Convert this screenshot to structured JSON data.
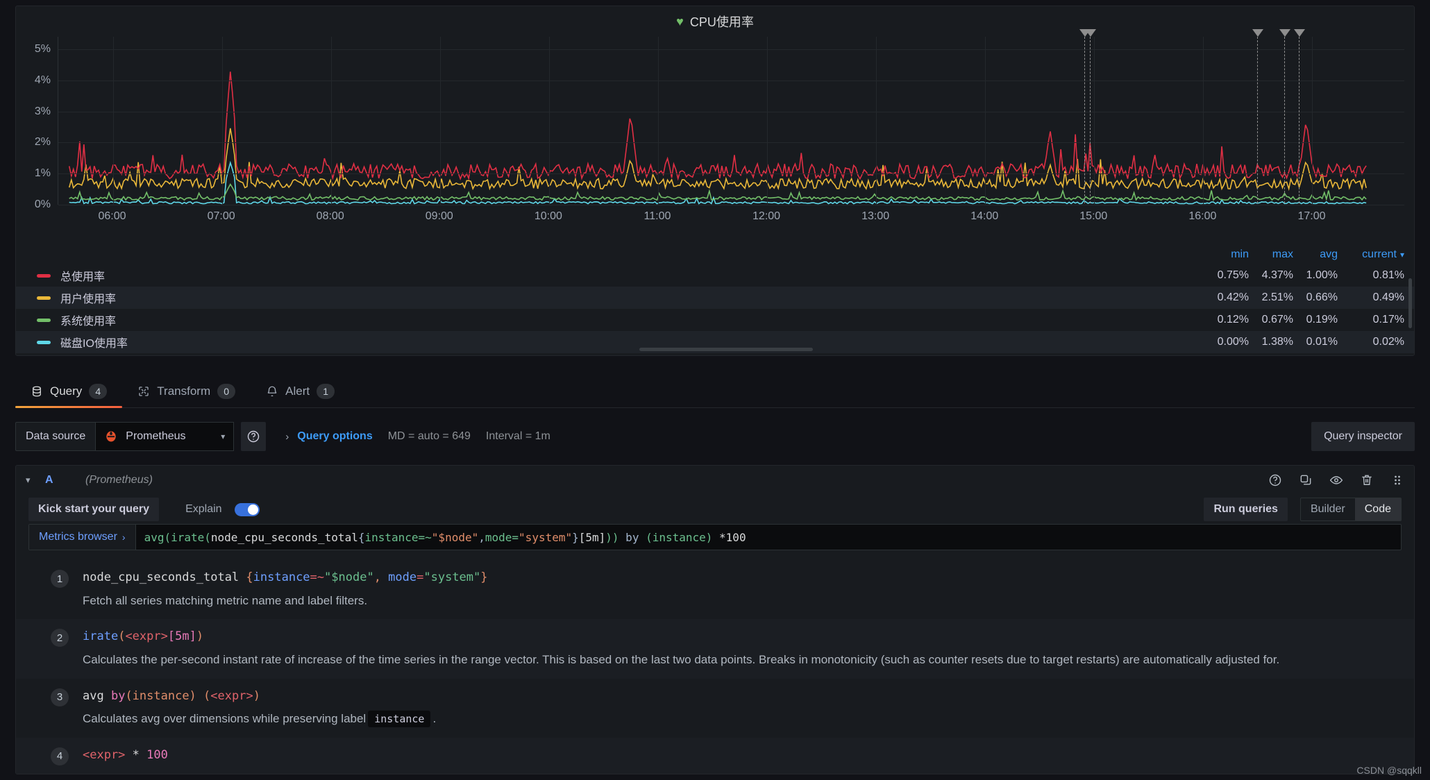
{
  "panel": {
    "title": "CPU使用率",
    "status_icon": "heart-icon"
  },
  "chart_data": {
    "type": "line",
    "title": "CPU使用率",
    "xlabel": "",
    "ylabel": "",
    "ylim": [
      0,
      5.4
    ],
    "ytick_labels": [
      "0%",
      "1%",
      "2%",
      "3%",
      "4%",
      "5%"
    ],
    "ytick_values": [
      0,
      1,
      2,
      3,
      4,
      5
    ],
    "xtick_labels": [
      "06:00",
      "07:00",
      "08:00",
      "09:00",
      "10:00",
      "11:00",
      "12:00",
      "13:00",
      "14:00",
      "15:00",
      "16:00",
      "17:00"
    ],
    "grid": true,
    "legend_position": "bottom-table",
    "annotations": [
      {
        "x": "14:55"
      },
      {
        "x": "14:58"
      },
      {
        "x": "16:30"
      },
      {
        "x": "16:45"
      },
      {
        "x": "16:53"
      }
    ],
    "series": [
      {
        "name": "总使用率",
        "color": "#e02f44",
        "min": "0.75%",
        "max": "4.37%",
        "avg": "1.00%",
        "current": "0.81%",
        "baseline": 1.05,
        "noise": 0.22,
        "spikes": [
          [
            7.08,
            4.37
          ],
          [
            10.75,
            2.95
          ],
          [
            14.6,
            2.4
          ],
          [
            16.95,
            2.75
          ]
        ]
      },
      {
        "name": "用户使用率",
        "color": "#eab839",
        "min": "0.42%",
        "max": "2.51%",
        "avg": "0.66%",
        "current": "0.49%",
        "baseline": 0.66,
        "noise": 0.15,
        "spikes": [
          [
            7.08,
            2.51
          ],
          [
            10.75,
            1.5
          ],
          [
            14.6,
            1.3
          ],
          [
            16.95,
            1.45
          ]
        ]
      },
      {
        "name": "系统使用率",
        "color": "#73bf69",
        "min": "0.12%",
        "max": "0.67%",
        "avg": "0.19%",
        "current": "0.17%",
        "baseline": 0.2,
        "noise": 0.05,
        "spikes": [
          [
            7.08,
            0.67
          ]
        ]
      },
      {
        "name": "磁盘IO使用率",
        "color": "#5fd7e8",
        "min": "0.00%",
        "max": "1.38%",
        "avg": "0.01%",
        "current": "0.02%",
        "baseline": 0.06,
        "noise": 0.03,
        "spikes": [
          [
            7.08,
            1.38
          ]
        ]
      }
    ],
    "columns": [
      "min",
      "max",
      "avg",
      "current"
    ],
    "sorted_column": "current"
  },
  "tabs": [
    {
      "label": "Query",
      "badge": "4",
      "icon": "database-icon",
      "active": true
    },
    {
      "label": "Transform",
      "badge": "0",
      "icon": "transform-icon",
      "active": false
    },
    {
      "label": "Alert",
      "badge": "1",
      "icon": "bell-icon",
      "active": false
    }
  ],
  "datasource_row": {
    "label": "Data source",
    "selected": "Prometheus",
    "logo_icon": "prometheus-icon",
    "caret_icon": "chevron-down-icon",
    "help_icon": "question-circle-icon",
    "expand_icon": "chevron-right-icon",
    "query_options_label": "Query options",
    "max_data_points": "MD = auto = 649",
    "interval": "Interval = 1m",
    "query_inspector_label": "Query inspector"
  },
  "query": {
    "collapse_icon": "chevron-down-icon",
    "ref_id": "A",
    "datasource_note": "(Prometheus)",
    "row_icons": [
      "help-circle-icon",
      "duplicate-icon",
      "eye-icon",
      "trash-icon",
      "drag-handle-icon"
    ],
    "kick_start_label": "Kick start your query",
    "explain_label": "Explain",
    "explain_on": true,
    "run_queries_label": "Run queries",
    "mode_options": [
      "Builder",
      "Code"
    ],
    "mode_selected": "Code",
    "metrics_browser_label": "Metrics browser",
    "metrics_browser_chevron": "›",
    "expression": "avg(irate(node_cpu_seconds_total{instance=~\"$node\",mode=\"system\"}[5m])) by (instance) *100",
    "code_parts": {
      "fn_avg": "avg(",
      "fn_irate": "irate(",
      "metric": "node_cpu_seconds_total",
      "brace_open": "{",
      "label1": "instance",
      "op1": "=~",
      "val1": "\"$node\"",
      "comma": ",",
      "label2": "mode",
      "op2": "=",
      "val2": "\"system\"",
      "brace_close": "}",
      "range": "[5m]",
      "close": "))",
      "by": " by ",
      "group": "(instance)",
      "mult": " *100"
    }
  },
  "explain_steps": [
    {
      "num": "1",
      "code_metric": "node_cpu_seconds_total",
      "code_labels_open": " {",
      "code_label1": "instance",
      "code_op1": "=~",
      "code_val1": "\"$node\"",
      "code_sep": ", ",
      "code_label2": "mode",
      "code_op2": "=",
      "code_val2": "\"system\"",
      "code_labels_close": "}",
      "desc": "Fetch all series matching metric name and label filters."
    },
    {
      "num": "2",
      "code_fn": "irate",
      "code_paren_open": "(",
      "code_expr": "<expr>",
      "code_range": "[5m]",
      "code_paren_close": ")",
      "desc": "Calculates the per-second instant rate of increase of the time series in the range vector. This is based on the last two data points. Breaks in monotonicity (such as counter resets due to target restarts) are automatically adjusted for."
    },
    {
      "num": "3",
      "code_agg": "avg ",
      "code_by": "by",
      "code_group": "(instance)",
      "code_space": " ",
      "code_expr_open": "(",
      "code_expr": "<expr>",
      "code_expr_close": ")",
      "desc_before": "Calculates avg over dimensions while preserving label",
      "desc_chip": "instance",
      "desc_after": "."
    },
    {
      "num": "4",
      "code_expr": "<expr>",
      "code_op": " * ",
      "code_num": "100"
    }
  ],
  "watermark": "CSDN @sqqkll"
}
